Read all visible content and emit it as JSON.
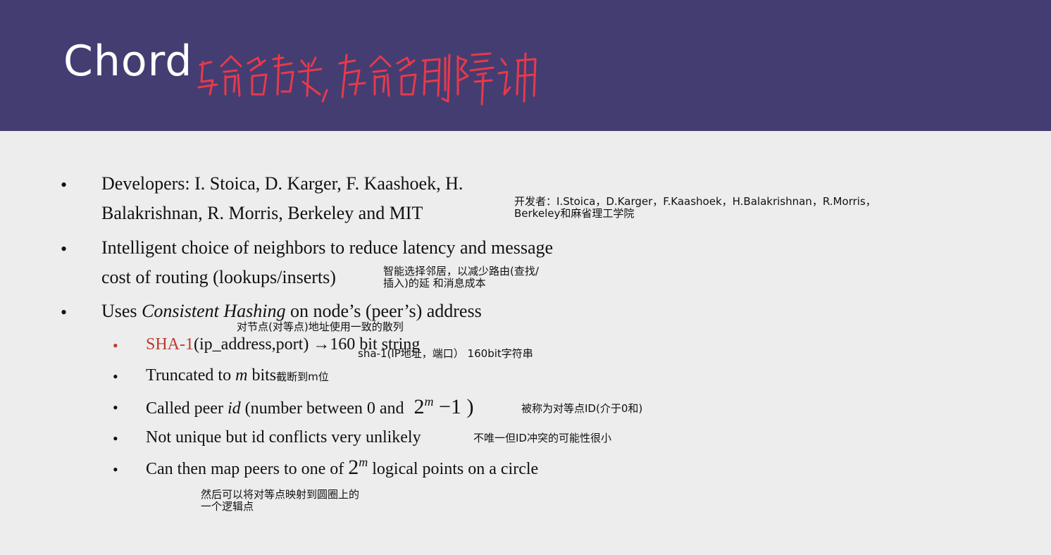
{
  "slide": {
    "title": "Chord",
    "handwritten_annotation": "与命名有关，在命名那章讲"
  },
  "bullets": [
    {
      "line1": "Developers: I. Stoica, D. Karger, F. Kaashoek, H.",
      "line2": "Balakrishnan, R. Morris, Berkeley and MIT",
      "note_line1": "开发者：I.Stoica，D.Karger，F.Kaashoek，H.Balakrishnan，R.Morris，",
      "note_line2": "Berkeley和麻省理工学院"
    },
    {
      "line1": "Intelligent choice of neighbors to reduce latency and message",
      "line2": "cost of routing (lookups/inserts)",
      "note_line1": "智能选择邻居，以减少路由(查找/",
      "note_line2": "插入)的延   和消息成本"
    },
    {
      "prefix": "Uses ",
      "emphasis": "Consistent Hashing",
      "suffix": " on node’s (peer’s) address",
      "note": "对节点(对等点)地址使用一致的散列"
    }
  ],
  "subbullets": [
    {
      "highlight": "SHA-1",
      "text": "(ip_address,port) →160 bit string",
      "note": "sha-1(IP地址，端口）   160bit字符串"
    },
    {
      "text_before": "Truncated to ",
      "var": "m",
      "text_after": " bits",
      "note": "截断到m位"
    },
    {
      "text_before": "Called peer ",
      "var": "id",
      "text_after": " (number between 0 and ",
      "math_base": "2",
      "math_exp": "m",
      "math_rest": " −1 )",
      "note": "被称为对等点ID(介于0和)"
    },
    {
      "text": "Not unique but id conflicts very unlikely",
      "note": "不唯一但ID冲突的可能性很小"
    },
    {
      "text_before": "Can then map peers to one of ",
      "math_base": "2",
      "math_exp": "m",
      "text_after": " logical points on a circle",
      "note_line1": "然后可以将对等点映射到圆圈上的",
      "note_line2": "一个逻辑点"
    }
  ],
  "bullet_glyph": "•",
  "colors": {
    "header_bg": "#433d72",
    "content_bg": "#ededed",
    "highlight": "#c0392b",
    "handwriting": "#e8394a"
  }
}
